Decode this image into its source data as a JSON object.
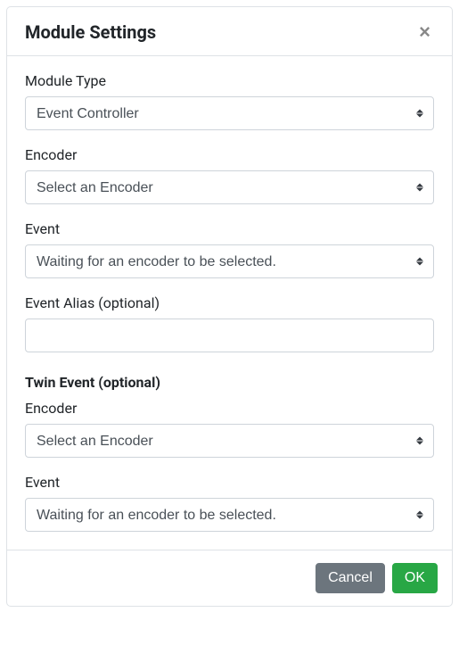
{
  "modal": {
    "title": "Module Settings"
  },
  "form": {
    "moduleType": {
      "label": "Module Type",
      "value": "Event Controller"
    },
    "encoder": {
      "label": "Encoder",
      "value": "Select an Encoder"
    },
    "event": {
      "label": "Event",
      "value": "Waiting for an encoder to be selected."
    },
    "eventAlias": {
      "label": "Event Alias (optional)",
      "value": ""
    },
    "twinSection": {
      "label": "Twin Event (optional)"
    },
    "twinEncoder": {
      "label": "Encoder",
      "value": "Select an Encoder"
    },
    "twinEvent": {
      "label": "Event",
      "value": "Waiting for an encoder to be selected."
    }
  },
  "footer": {
    "cancel": "Cancel",
    "ok": "OK"
  }
}
